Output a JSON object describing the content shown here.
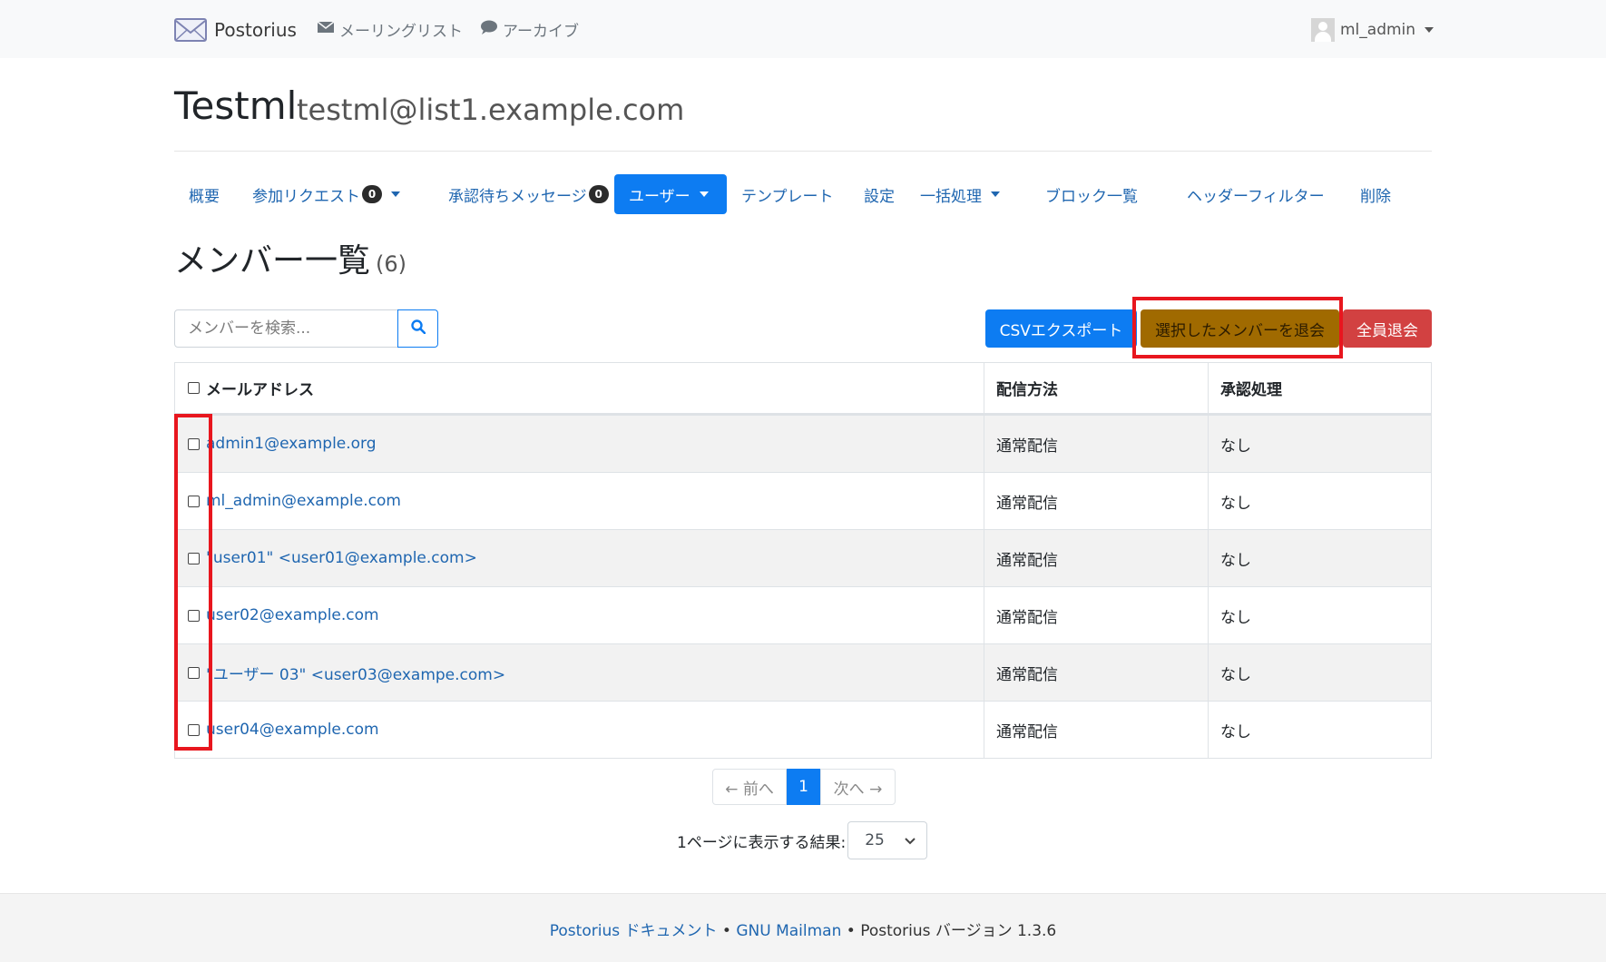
{
  "navbar": {
    "brand": "Postorius",
    "lists_label": "メーリングリスト",
    "archives_label": "アーカイブ",
    "user": "ml_admin"
  },
  "list": {
    "name": "Testml",
    "address": "testml@list1.example.com"
  },
  "tabs": [
    {
      "label": "概要"
    },
    {
      "label": "参加リクエスト",
      "badge": "0"
    },
    {
      "label": "承認待ちメッセージ",
      "badge": "0"
    },
    {
      "label": "ユーザー"
    },
    {
      "label": "テンプレート"
    },
    {
      "label": "設定"
    },
    {
      "label": "一括処理"
    },
    {
      "label": "ブロック一覧"
    },
    {
      "label": "ヘッダーフィルター"
    },
    {
      "label": "削除"
    }
  ],
  "page": {
    "title": "メンバー一覧",
    "count": "(6)"
  },
  "search": {
    "placeholder": "メンバーを検索..."
  },
  "actions": {
    "export": "CSVエクスポート",
    "unsubscribe_selected": "選択したメンバーを退会",
    "unsubscribe_all": "全員退会"
  },
  "table": {
    "headers": {
      "email": "メールアドレス",
      "delivery": "配信方法",
      "moderation": "承認処理"
    },
    "rows": [
      {
        "email": "admin1@example.org",
        "delivery": "通常配信",
        "moderation": "なし"
      },
      {
        "email": "ml_admin@example.com",
        "delivery": "通常配信",
        "moderation": "なし"
      },
      {
        "email": "\"user01\" <user01@example.com>",
        "delivery": "通常配信",
        "moderation": "なし"
      },
      {
        "email": "user02@example.com",
        "delivery": "通常配信",
        "moderation": "なし"
      },
      {
        "email": "\"ユーザー 03\" <user03@exampe.com>",
        "delivery": "通常配信",
        "moderation": "なし"
      },
      {
        "email": "user04@example.com",
        "delivery": "通常配信",
        "moderation": "なし"
      }
    ]
  },
  "pagination": {
    "prev": "← 前へ",
    "current": "1",
    "next": "次へ →"
  },
  "per_page": {
    "label": "1ページに表示する結果:",
    "value": "25"
  },
  "footer": {
    "docs": "Postorius ドキュメント",
    "sep1": " • ",
    "mailman": "GNU Mailman",
    "version": " • Postorius バージョン 1.3.6"
  },
  "colors": {
    "primary": "#0d7cf2",
    "warning_button": "#a06a00",
    "danger_button": "#d24141",
    "highlight": "#e8161e"
  }
}
